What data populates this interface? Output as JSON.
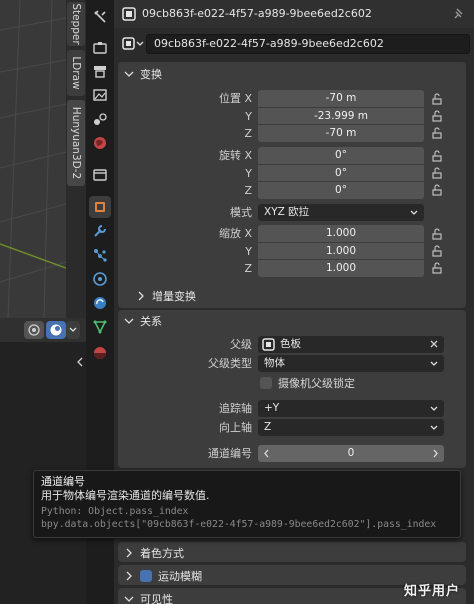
{
  "sidebar_tabs": [
    "Stepper",
    "LDraw",
    "Hunyuan3D-2"
  ],
  "header": {
    "object_name": "09cb863f-e022-4f57-a989-9bee6ed2c602"
  },
  "object_row": {
    "name": "09cb863f-e022-4f57-a989-9bee6ed2c602"
  },
  "transform": {
    "title": "变换",
    "location": {
      "label_x": "位置 X",
      "x": "-70 m",
      "y": "-23.999 m",
      "z": "-70 m"
    },
    "rotation": {
      "label_x": "旋转 X",
      "x": "0°",
      "y": "0°",
      "z": "0°"
    },
    "mode_label": "模式",
    "mode_value": "XYZ 欧拉",
    "scale": {
      "label_x": "缩放 X",
      "x": "1.000",
      "y": "1.000",
      "z": "1.000"
    },
    "axis_y": "Y",
    "axis_z": "Z",
    "delta_title": "增量变换"
  },
  "relations": {
    "title": "关系",
    "parent_label": "父级",
    "parent_value": "色板",
    "parent_type_label": "父级类型",
    "parent_type_value": "物体",
    "camera_lock_label": "摄像机父级锁定",
    "tracking_axis_label": "追踪轴",
    "tracking_axis_value": "+Y",
    "up_axis_label": "向上轴",
    "up_axis_value": "Z",
    "pass_index_label": "通道编号",
    "pass_index_value": "0"
  },
  "tooltip": {
    "title": "通道编号",
    "description": "用于物体编号渲染通道的编号数值.",
    "python": "Python: Object.pass_index",
    "path": "bpy.data.objects[\"09cb863f-e022-4f57-a989-9bee6ed2c602\"].pass_index"
  },
  "collapsed_panels": {
    "shading": "着色方式",
    "motion_blur": "运动模糊",
    "visibility": "可见性"
  },
  "watermark": "知乎用户",
  "colors": {
    "accent": "#4772b3",
    "panel": "#3d3d3d",
    "field": "#545454",
    "background": "#2b2b2b"
  }
}
